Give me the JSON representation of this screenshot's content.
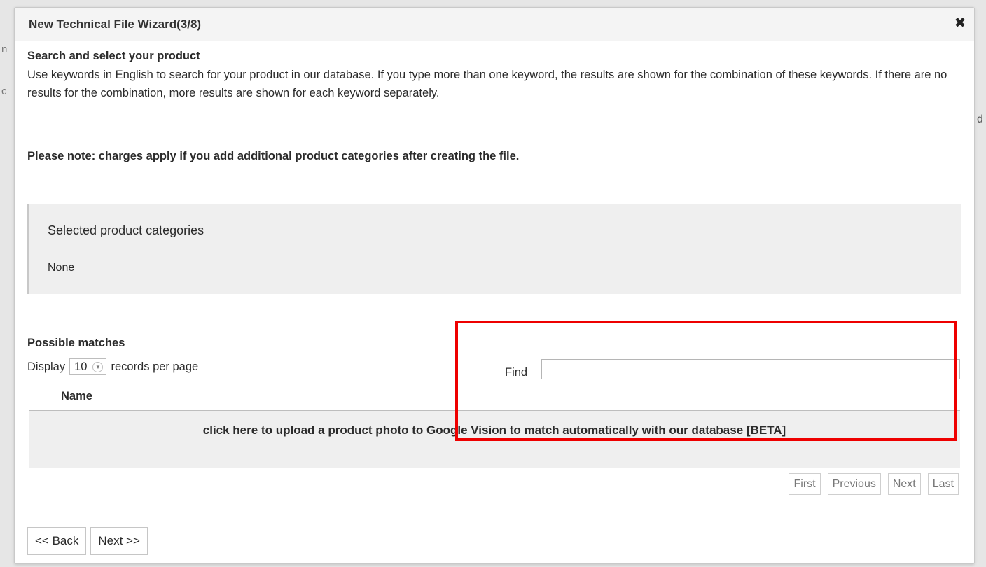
{
  "background": {
    "left_fragment_1": "n",
    "left_fragment_2": "c",
    "right_fragment": "d"
  },
  "dialog": {
    "title": "New Technical File Wizard(3/8)",
    "close_glyph": "✖",
    "heading": "Search and select your product",
    "description": "Use keywords in English to search for your product in our database. If you type more than one keyword, the results are shown for the combination of these keywords. If there are no results for the combination, more results are shown for each keyword separately.",
    "note": "Please note: charges apply if you add additional product categories after creating the file."
  },
  "selected": {
    "title": "Selected product categories",
    "value": "None"
  },
  "matches": {
    "title": "Possible matches",
    "display_prefix": "Display",
    "per_page": "10",
    "display_suffix": "records per page",
    "find_label": "Find",
    "find_value": "",
    "column_name": "Name",
    "upload_text": "click here to upload a product photo to Google Vision to match automatically with our database [BETA]"
  },
  "pager": {
    "first": "First",
    "previous": "Previous",
    "next": "Next",
    "last": "Last"
  },
  "nav": {
    "back": "<< Back",
    "next": "Next >>"
  },
  "colors": {
    "highlight": "#ee0000",
    "panel_bg": "#efefef"
  }
}
